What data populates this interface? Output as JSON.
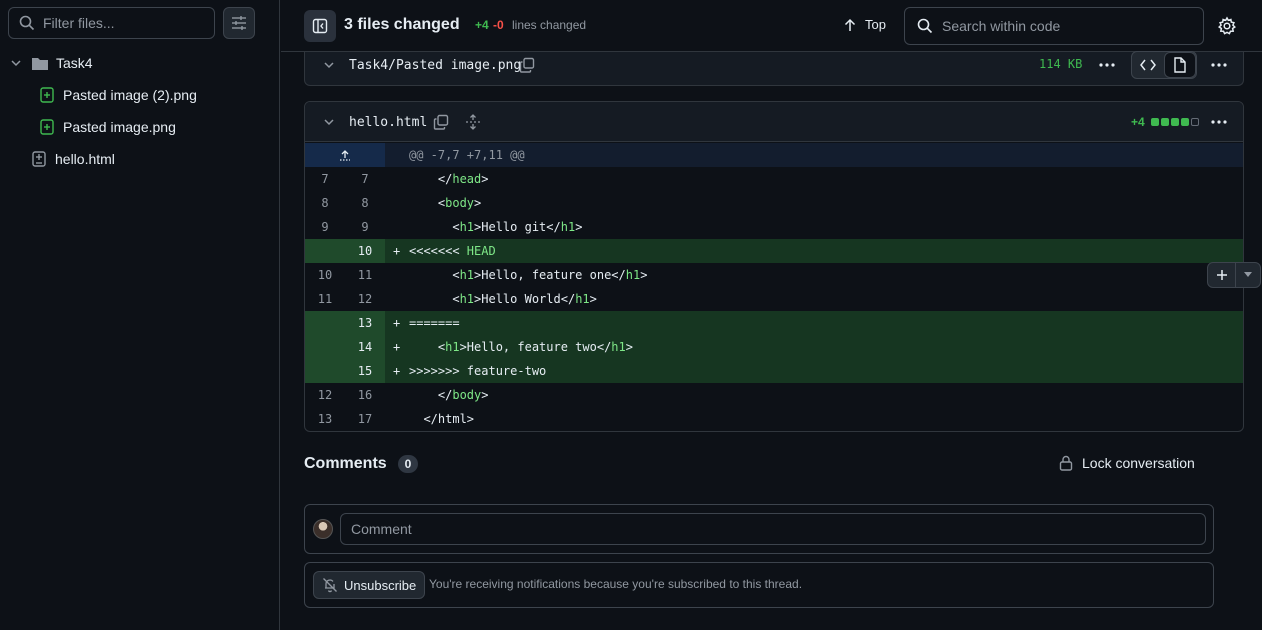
{
  "sidebar": {
    "filter_placeholder": "Filter files...",
    "tree": [
      {
        "label": "Task4",
        "type": "folder"
      },
      {
        "label": "Pasted image (2).png",
        "type": "added"
      },
      {
        "label": "Pasted image.png",
        "type": "added"
      },
      {
        "label": "hello.html",
        "type": "modified"
      }
    ]
  },
  "header": {
    "files_changed": "3 files changed",
    "additions": "+4",
    "deletions": "-0",
    "lines_changed": "lines changed",
    "top_label": "Top",
    "search_placeholder": "Search within code"
  },
  "file1": {
    "name": "Task4/Pasted image.png",
    "size": "114 KB"
  },
  "file2": {
    "name": "hello.html",
    "additions": "+4",
    "diffstat": [
      "add",
      "add",
      "add",
      "add",
      "neutral"
    ],
    "hunk": "@@ -7,7 +7,11 @@",
    "lines": [
      {
        "old": "7",
        "new": "7",
        "type": "ctx",
        "text": "    </head>"
      },
      {
        "old": "8",
        "new": "8",
        "type": "ctx",
        "text": "    <body>"
      },
      {
        "old": "9",
        "new": "9",
        "type": "ctx",
        "text": "      <h1>Hello git</h1>"
      },
      {
        "old": "",
        "new": "10",
        "type": "add",
        "text": "<<<<<<< HEAD"
      },
      {
        "old": "10",
        "new": "11",
        "type": "ctx",
        "text": "      <h1>Hello, feature one</h1>"
      },
      {
        "old": "11",
        "new": "12",
        "type": "ctx",
        "text": "      <h1>Hello World</h1>"
      },
      {
        "old": "",
        "new": "13",
        "type": "add",
        "text": "======="
      },
      {
        "old": "",
        "new": "14",
        "type": "add",
        "text": "    <h1>Hello, feature two</h1>"
      },
      {
        "old": "",
        "new": "15",
        "type": "add",
        "text": ">>>>>>> feature-two"
      },
      {
        "old": "12",
        "new": "16",
        "type": "ctx",
        "text": "    </body>"
      },
      {
        "old": "13",
        "new": "17",
        "type": "ctx",
        "text": "  </html>"
      }
    ]
  },
  "comments": {
    "title": "Comments",
    "count": "0",
    "lock_label": "Lock conversation",
    "input_placeholder": "Comment",
    "unsubscribe_label": "Unsubscribe",
    "subscription_text": "You're receiving notifications because you're subscribed to this thread."
  },
  "colors": {
    "add": "#3fb950",
    "del": "#f85149",
    "tag": "#7ee787"
  }
}
